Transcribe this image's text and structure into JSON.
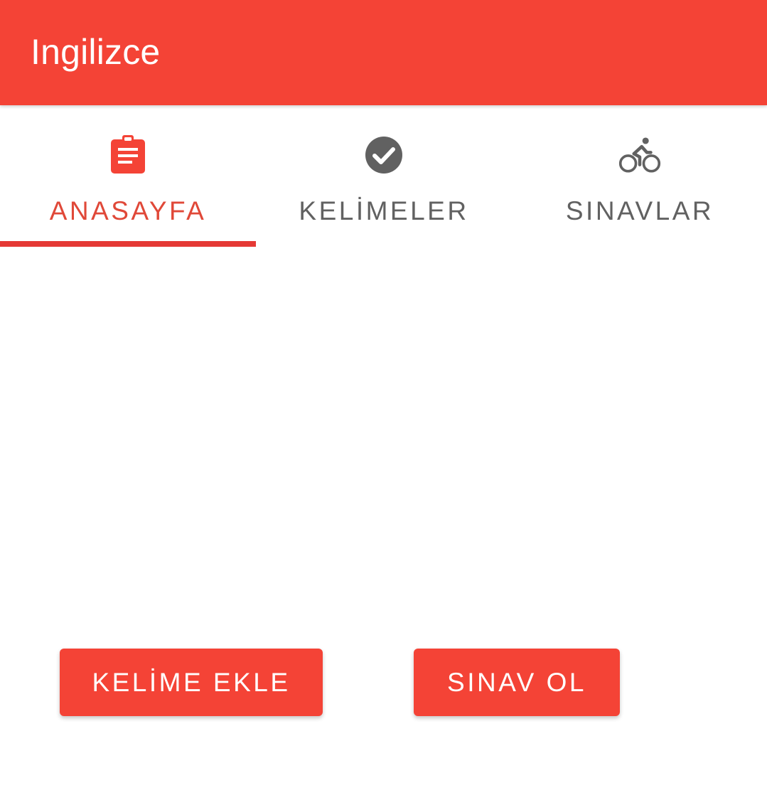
{
  "app_bar": {
    "title": "Ingilizce",
    "color": "#F44336"
  },
  "tabs": [
    {
      "label": "ANASAYFA",
      "icon": "clipboard-icon",
      "active": true
    },
    {
      "label": "KELİMELER",
      "icon": "check-circle-icon",
      "active": false
    },
    {
      "label": "SINAVLAR",
      "icon": "bike-icon",
      "active": false
    }
  ],
  "buttons": {
    "add_word": "KELİME EKLE",
    "take_exam": "SINAV OL"
  },
  "colors": {
    "accent": "#F44336",
    "active_tab_text": "#E04838",
    "inactive_tab": "#616161"
  }
}
